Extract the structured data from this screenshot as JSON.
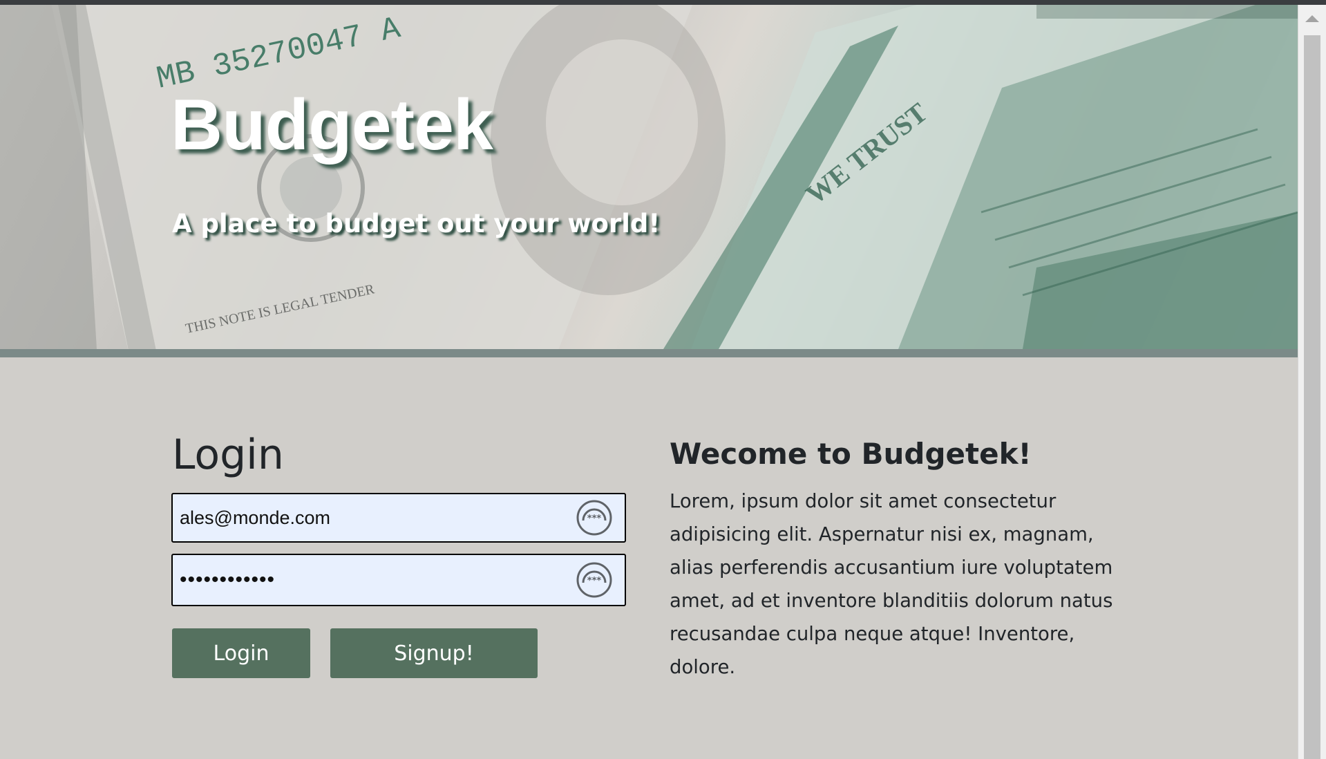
{
  "hero": {
    "title": "Budgetek",
    "tagline": "A place to budget out your world!"
  },
  "login": {
    "heading": "Login",
    "email_value": "ales@monde.com",
    "password_value": "alespassword",
    "login_label": "Login",
    "signup_label": "Signup!"
  },
  "welcome": {
    "heading": "Wecome to Budgetek!",
    "body": "Lorem, ipsum dolor sit amet consectetur adipisicing elit. Aspernatur nisi ex, magnam, alias perferendis accusantium iure voluptatem amet, ad et inventore blanditiis dolorum natus recusandae culpa neque atque! Inventore, dolore."
  },
  "icons": {
    "password_manager": "password-manager-key-icon",
    "scroll_up": "scroll-up-arrow-icon"
  },
  "colors": {
    "accent": "#55715f",
    "page_background": "#d0ceca",
    "input_autofill": "#e8f0fe",
    "text": "#212529"
  }
}
